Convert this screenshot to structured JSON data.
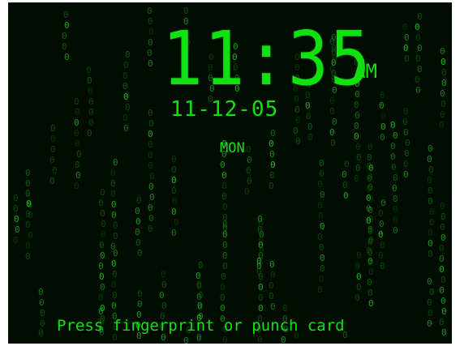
{
  "clock": {
    "time": "11:35",
    "meridiem": "AM",
    "date": "11-12-05",
    "weekday": "MON"
  },
  "prompt": "Press fingerprint or punch card",
  "colors": {
    "background": "#020d02",
    "accent": "#11e011",
    "rain_bright": "#1bb81b",
    "rain_dim": "#0b5a0b"
  },
  "decoration": {
    "style": "matrix-digital-rain",
    "glyph": "0"
  }
}
